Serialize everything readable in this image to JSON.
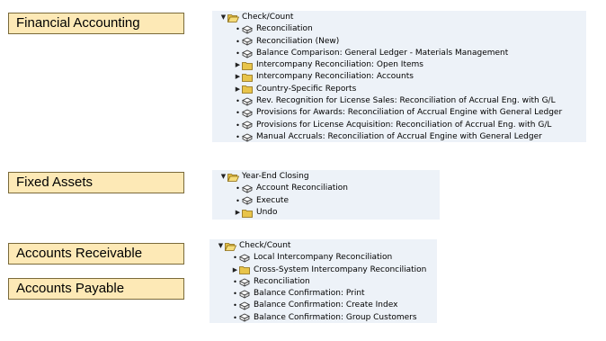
{
  "labels": {
    "financial_accounting": "Financial Accounting",
    "fixed_assets": "Fixed Assets",
    "accounts_receivable": "Accounts Receivable",
    "accounts_payable": "Accounts Payable"
  },
  "trees": {
    "fa": {
      "root": "Check/Count",
      "items": [
        {
          "label": "Reconciliation",
          "icon": "transaction-icon"
        },
        {
          "label": "Reconciliation (New)",
          "icon": "transaction-icon"
        },
        {
          "label": "Balance Comparison: General Ledger - Materials Management",
          "icon": "transaction-icon"
        },
        {
          "label": "Intercompany Reconciliation: Open Items",
          "icon": "folder-icon"
        },
        {
          "label": "Intercompany Reconciliation: Accounts",
          "icon": "folder-icon"
        },
        {
          "label": "Country-Specific Reports",
          "icon": "folder-icon"
        },
        {
          "label": "Rev. Recognition for License Sales: Reconciliation of Accrual Eng. with G/L",
          "icon": "transaction-icon"
        },
        {
          "label": "Provisions for Awards: Reconciliation of Accrual Engine with General Ledger",
          "icon": "transaction-icon"
        },
        {
          "label": "Provisions for License Acquisition: Reconciliation of Accrual Eng. with G/L",
          "icon": "transaction-icon"
        },
        {
          "label": "Manual Accruals: Reconciliation of Accrual Engine with General Ledger",
          "icon": "transaction-icon"
        }
      ]
    },
    "fixed": {
      "root": "Year-End Closing",
      "items": [
        {
          "label": "Account Reconciliation",
          "icon": "transaction-icon"
        },
        {
          "label": "Execute",
          "icon": "transaction-icon"
        },
        {
          "label": "Undo",
          "icon": "folder-icon"
        }
      ]
    },
    "ar": {
      "root": "Check/Count",
      "items": [
        {
          "label": "Local Intercompany Reconciliation",
          "icon": "transaction-icon"
        },
        {
          "label": "Cross-System Intercompany Reconciliation",
          "icon": "folder-icon"
        },
        {
          "label": "Reconciliation",
          "icon": "transaction-icon"
        },
        {
          "label": "Balance Confirmation: Print",
          "icon": "transaction-icon"
        },
        {
          "label": "Balance Confirmation: Create Index",
          "icon": "transaction-icon"
        },
        {
          "label": "Balance Confirmation: Group Customers",
          "icon": "transaction-icon"
        }
      ]
    }
  },
  "colors": {
    "label_fill": "#fde9b6",
    "tree_background": "#edf2f8",
    "folder": "#e8c44a"
  }
}
